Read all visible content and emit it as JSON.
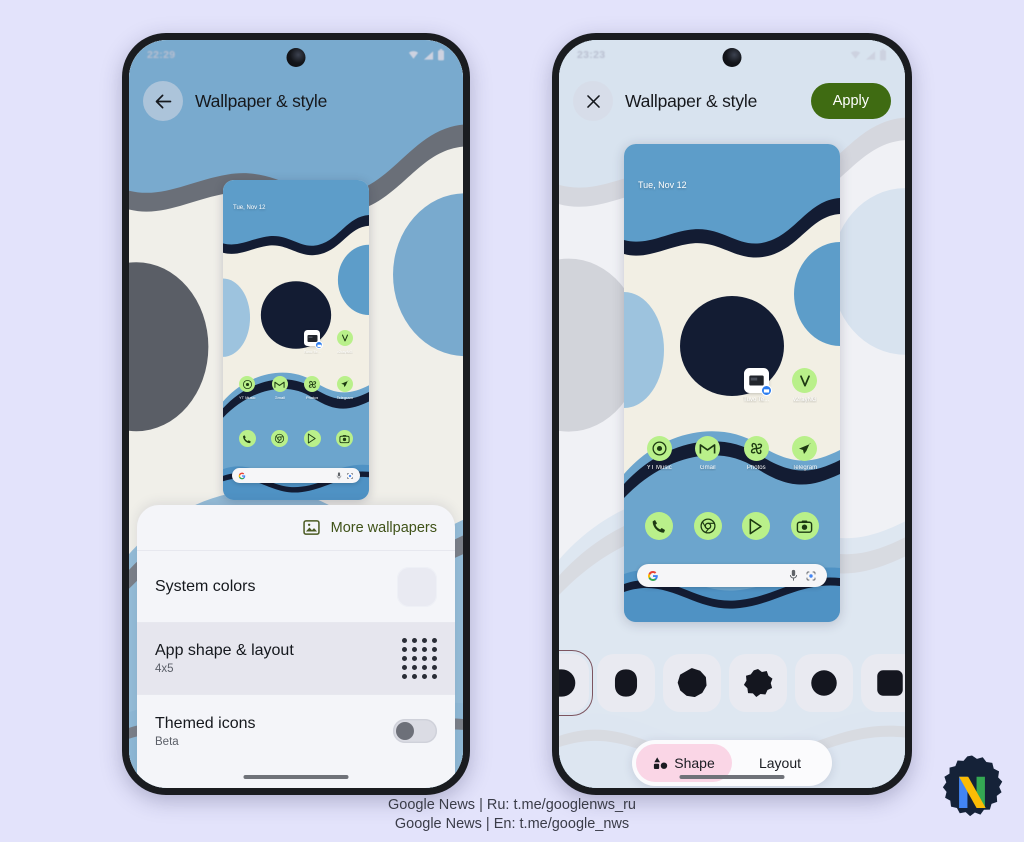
{
  "page": {
    "background_color": "#e3e3fb"
  },
  "left_phone": {
    "status_bar": {
      "time": "22:29",
      "icons": [
        "wifi-icon",
        "signal-icon",
        "battery-icon"
      ]
    },
    "app_bar": {
      "back_icon": "arrow-back-icon",
      "title": "Wallpaper & style"
    },
    "preview": {
      "date_widget": "Tue, Nov 12",
      "folder": {
        "label": "Tuvo Te...",
        "badge_icon": "folder-badge-icon"
      },
      "apps_row_1": [
        {
          "label": "v2rayNG",
          "icon": "v2rayng-icon"
        }
      ],
      "apps_row_2": [
        {
          "label": "YT Music",
          "icon": "yt-music-icon"
        },
        {
          "label": "Gmail",
          "icon": "gmail-icon"
        },
        {
          "label": "Photos",
          "icon": "photos-icon"
        },
        {
          "label": "Telegram",
          "icon": "telegram-icon"
        }
      ],
      "dock": [
        {
          "label": "Phone",
          "icon": "phone-icon"
        },
        {
          "label": "Chrome",
          "icon": "chrome-icon"
        },
        {
          "label": "Play Store",
          "icon": "play-store-icon"
        },
        {
          "label": "Camera",
          "icon": "camera-icon"
        }
      ],
      "search_bar": {
        "leading_icon": "google-g-icon",
        "mic_icon": "mic-icon",
        "lens_icon": "google-lens-icon"
      }
    },
    "sheet": {
      "more_wallpapers": {
        "icon": "image-icon",
        "label": "More wallpapers"
      },
      "options": [
        {
          "title": "System colors",
          "subtitle": "",
          "control": "color-swatch",
          "selected": false
        },
        {
          "title": "App shape & layout",
          "subtitle": "4x5",
          "control": "grid-preview",
          "selected": true
        },
        {
          "title": "Themed icons",
          "subtitle": "Beta",
          "control": "toggle-off",
          "selected": false
        }
      ]
    }
  },
  "right_phone": {
    "status_bar": {
      "time": "23:23",
      "icons": [
        "wifi-icon",
        "signal-icon",
        "battery-icon"
      ]
    },
    "app_bar": {
      "close_icon": "close-icon",
      "title": "Wallpaper & style",
      "apply_label": "Apply",
      "apply_color": "#3f6b12"
    },
    "preview": {
      "date_widget": "Tue, Nov 12",
      "folder": {
        "label": "Tuvo Te...",
        "badge_icon": "folder-badge-icon"
      },
      "apps_row_1": [
        {
          "label": "v2rayNG",
          "icon": "v2rayng-icon"
        }
      ],
      "apps_row_2": [
        {
          "label": "YT Music",
          "icon": "yt-music-icon"
        },
        {
          "label": "Gmail",
          "icon": "gmail-icon"
        },
        {
          "label": "Photos",
          "icon": "photos-icon"
        },
        {
          "label": "Telegram",
          "icon": "telegram-icon"
        }
      ],
      "dock": [
        {
          "label": "Phone",
          "icon": "phone-icon"
        },
        {
          "label": "Chrome",
          "icon": "chrome-icon"
        },
        {
          "label": "Play Store",
          "icon": "play-store-icon"
        },
        {
          "label": "Camera",
          "icon": "camera-icon"
        }
      ],
      "search_bar": {
        "leading_icon": "google-g-icon",
        "mic_icon": "mic-icon",
        "lens_icon": "google-lens-icon"
      }
    },
    "shape_carousel": {
      "shapes": [
        {
          "name": "arch-shape",
          "selected": true
        },
        {
          "name": "four-leaf-clover-shape",
          "selected": false
        },
        {
          "name": "seven-sided-cookie-shape",
          "selected": false
        },
        {
          "name": "nine-sided-star-shape",
          "selected": false
        },
        {
          "name": "circle-shape",
          "selected": false
        },
        {
          "name": "square-shape",
          "selected": false
        }
      ]
    },
    "segmented_control": {
      "tabs": [
        {
          "label": "Shape",
          "icon": "shapes-icon",
          "active": true
        },
        {
          "label": "Layout",
          "icon": "",
          "active": false
        }
      ],
      "active_background": "#fad6e6"
    }
  },
  "footer": {
    "line1": "Google News | Ru: t.me/googlenws_ru",
    "line2": "Google News | En: t.me/google_nws"
  },
  "watermark": {
    "name": "google-news-n-logo",
    "letter": "N"
  }
}
